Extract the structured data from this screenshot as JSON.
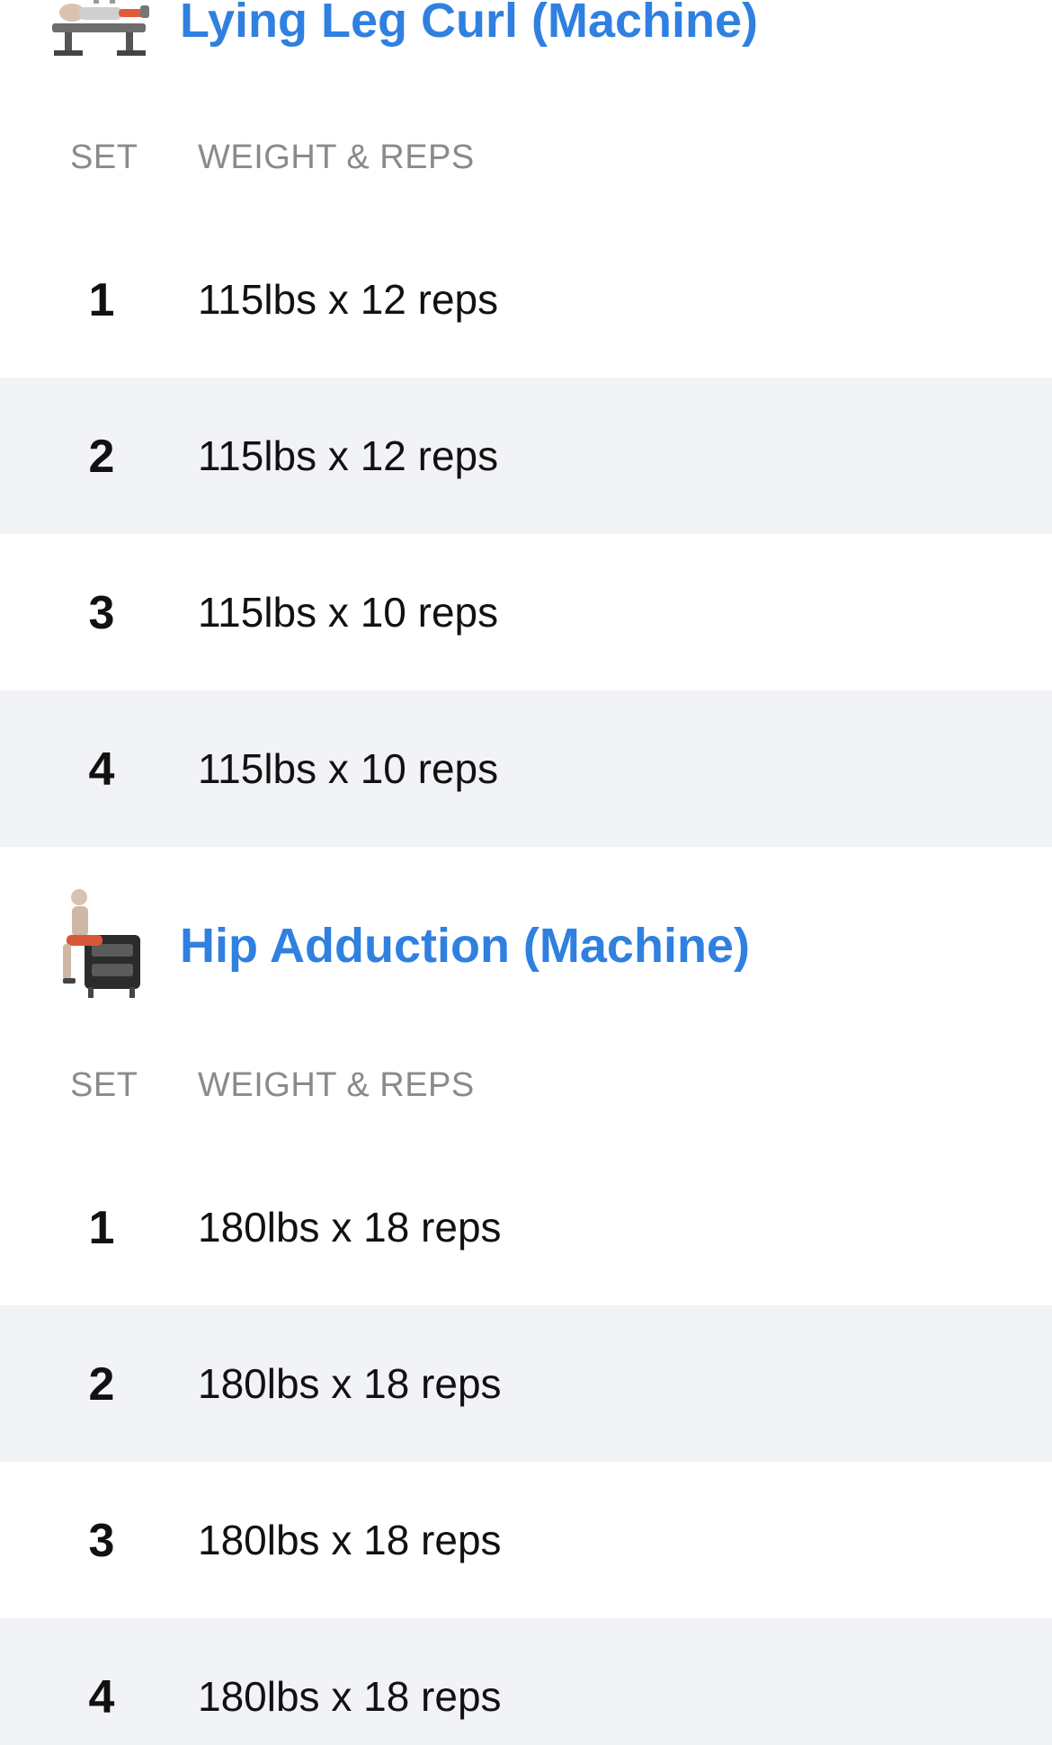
{
  "exercises": [
    {
      "title": "Lying Leg Curl (Machine)",
      "thumbnail_icon": "lying-leg-curl-machine-illustration",
      "columns": {
        "set": "SET",
        "weight_reps": "WEIGHT & REPS"
      },
      "sets": [
        {
          "set": "1",
          "value": "115lbs x 12 reps"
        },
        {
          "set": "2",
          "value": "115lbs x 12 reps"
        },
        {
          "set": "3",
          "value": "115lbs x 10 reps"
        },
        {
          "set": "4",
          "value": "115lbs x 10 reps"
        }
      ]
    },
    {
      "title": "Hip Adduction (Machine)",
      "thumbnail_icon": "hip-adduction-machine-illustration",
      "columns": {
        "set": "SET",
        "weight_reps": "WEIGHT & REPS"
      },
      "sets": [
        {
          "set": "1",
          "value": "180lbs x 18 reps"
        },
        {
          "set": "2",
          "value": "180lbs x 18 reps"
        },
        {
          "set": "3",
          "value": "180lbs x 18 reps"
        },
        {
          "set": "4",
          "value": "180lbs x 18 reps"
        }
      ]
    }
  ],
  "colors": {
    "accent": "#2f80e0",
    "row_shade": "#f2f3f7",
    "muted_text": "#8a8a8e"
  }
}
